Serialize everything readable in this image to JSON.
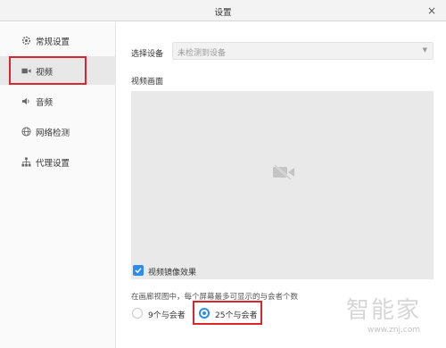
{
  "window": {
    "title": "设置",
    "close": "×"
  },
  "sidebar": {
    "items": [
      {
        "label": "常规设置",
        "icon": "gear-icon"
      },
      {
        "label": "视频",
        "icon": "camera-icon"
      },
      {
        "label": "音频",
        "icon": "speaker-icon"
      },
      {
        "label": "网络检测",
        "icon": "globe-icon"
      },
      {
        "label": "代理设置",
        "icon": "network-icon"
      }
    ],
    "active": "视频"
  },
  "video": {
    "device_label": "选择设备",
    "device_value": "未检测到设备",
    "preview_label": "视频画面",
    "mirror_label": "视频镜像效果",
    "mirror_checked": true,
    "grid_description": "在画廊视图中，每个屏幕最多可显示的与会者个数",
    "options": [
      "9个与会者",
      "25个与会者"
    ],
    "selected_option": "25个与会者"
  },
  "watermark": {
    "text": "智能家",
    "url": "www.znj.com"
  },
  "colors": {
    "accent": "#2d8cf0",
    "highlight": "#d7262c"
  }
}
